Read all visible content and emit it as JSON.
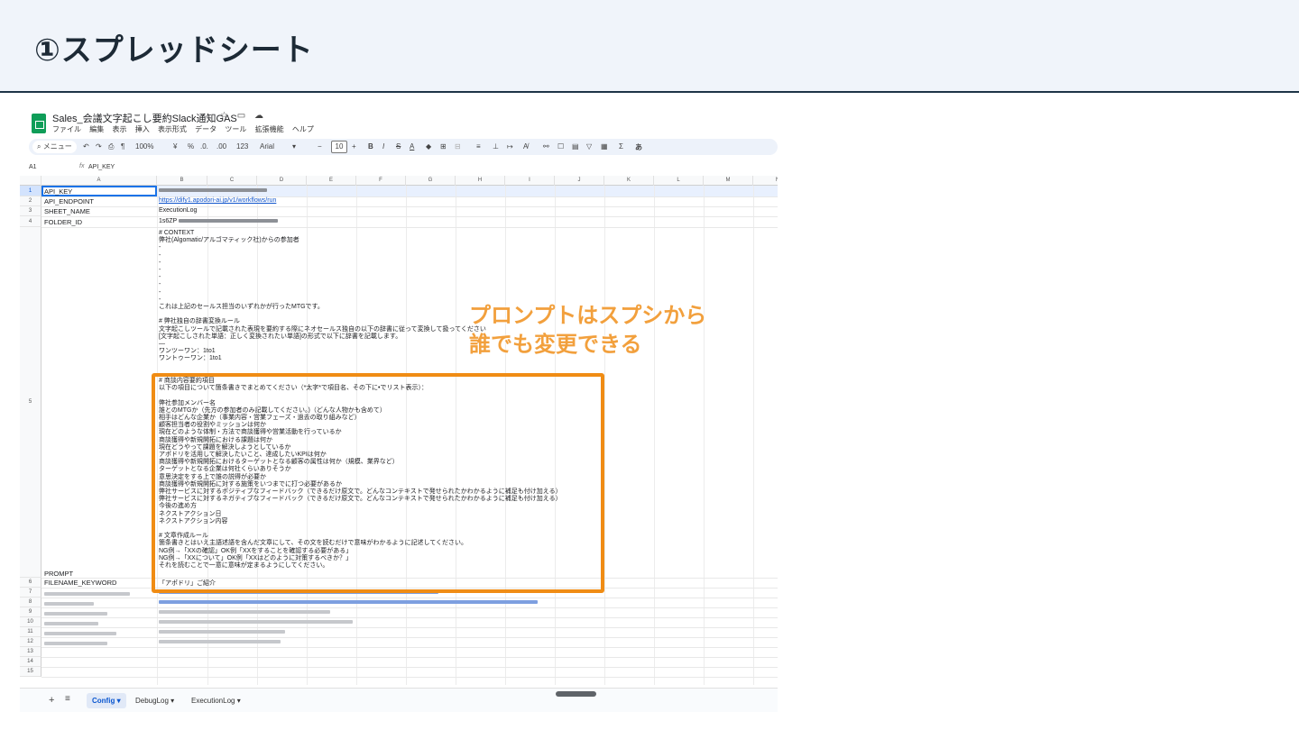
{
  "slide": {
    "title": "①スプレッドシート"
  },
  "sheet": {
    "doc_title": "Sales_会議文字起こし要約Slack通知GAS",
    "title_icons": [
      "star-icon",
      "folder-icon",
      "cloud-icon"
    ],
    "menu": [
      "ファイル",
      "編集",
      "表示",
      "挿入",
      "表示形式",
      "データ",
      "ツール",
      "拡張機能",
      "ヘルプ"
    ],
    "toolbar": {
      "search": "メニュー",
      "zoom": "100%",
      "currency": "¥",
      "percent": "%",
      "dec_less": ".0.",
      "dec_more": ".00",
      "number_format": "123",
      "font": "Arial",
      "font_size": "10",
      "minus": "−",
      "plus": "+",
      "bold": "B",
      "italic": "I",
      "strike": "S",
      "underline_a": "A",
      "sigma": "Σ",
      "input_tool": "あ"
    },
    "formula": {
      "cell_ref": "A1",
      "fx": "fx",
      "content": "API_KEY"
    },
    "columns": [
      "A",
      "B",
      "C",
      "D",
      "E",
      "F",
      "G",
      "H",
      "I",
      "J",
      "K",
      "L",
      "M",
      "N"
    ],
    "rows": [
      "1",
      "2",
      "3",
      "4",
      "5",
      "6",
      "7",
      "8",
      "9",
      "10",
      "11",
      "12",
      "13",
      "14",
      "15"
    ],
    "cells": {
      "a1": "API_KEY",
      "a2": "API_ENDPOINT",
      "b2": "https://dify1.apodori-ai.jp/v1/workflows/run",
      "a3": "SHEET_NAME",
      "b3": "ExecutionLog",
      "a4": "FOLDER_ID",
      "b4_prefix": "1s6ZP",
      "a5": "PROMPT",
      "a6": "FILENAME_KEYWORD",
      "b6": "「アポドリ」ご紹介"
    },
    "prompt_top": "# CONTEXT\n弊社(Algomatic/アルゴマティック社)からの参加者\n- \n- \n- \n- \n- \n- \n- \n- \nこれは上記のセールス担当のいずれかが行ったMTGです。\n\n# 弊社独自の辞書変換ルール\n文字起こしツールで記載された表現を要約する際にネオセールス独自の以下の辞書に従って変換して扱ってください\n[文字起こしされた単語：正しく変換されたい単語]の形式で以下に辞書を記載します。\n—\nワンツーワン：1to1\nワントゥーワン：1to1",
    "prompt_box": "# 商談内容要約項目\n以下の項目について箇条書きでまとめてください（*太字*で項目名、その下に•でリスト表示）：\n\n弊社参加メンバー名\n誰とのMTGか（先方の参加者のみ記載してください。)（どんな人物かも含めて）\n相手はどんな企業か（事業内容・営業フェーズ・過去の取り組みなど）\n顧客担当者の役割やミッションは何か\n現在どのような体制・方法で商談獲得や営業活動を行っているか\n商談獲得や新規開拓における課題は何か\n現在どうやって課題を解決しようとしているか\nアポドリを活用して解決したいこと、達成したいKPIは何か\n商談獲得や新規開拓におけるターゲットとなる顧客の属性は何か（規模、業界など）\nターゲットとなる企業は何社くらいありそうか\n意思決定をする上で誰の説得が必要か\n商談獲得や新規開拓に対する施策をいつまでに打つ必要があるか\n弊社サービスに対するポジティブなフィードバック（できるだけ原文で。どんなコンテキストで発せられたかわかるように補足も付け加える）\n弊社サービスに対するネガティブなフィードバック（できるだけ原文で。どんなコンテキストで発せられたかわかるように補足も付け加える）\n今後の進め方\nネクストアクション日\nネクストアクション内容\n\n# 文章作成ルール\n箇条書きとはいえ主語述語を含んだ文章にして、その文を読むだけで意味がわかるように記述してください。\nNG例→「XXの確認」OK例「XXをすることを確認する必要がある」\nNG例→「XXについて」OK例「XXはどのように対策するべきか？」\nそれを読むことで一意に意味が定まるようにしてください。",
    "tabs": [
      "Config",
      "DebugLog",
      "ExecutionLog"
    ],
    "active_tab": "Config"
  },
  "annotation": {
    "line1": "プロンプトはスプシから",
    "line2": "誰でも変更できる"
  },
  "colors": {
    "accent_orange": "#f08c14",
    "annotation": "#f2a03d",
    "sheets_green": "#0f9d58",
    "link": "#1155cc"
  }
}
